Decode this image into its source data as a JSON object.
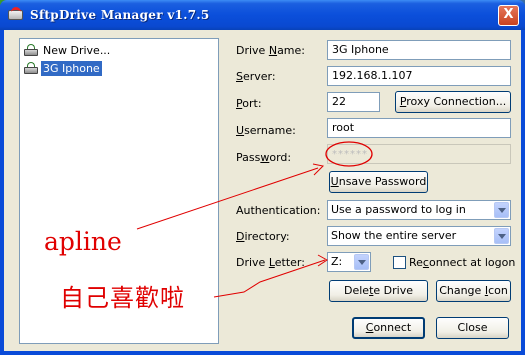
{
  "window": {
    "title": "SftpDrive Manager v1.7.5",
    "close_glyph": "X"
  },
  "drives": [
    {
      "label": "New Drive...",
      "icon": "network-drive-icon",
      "selected": false
    },
    {
      "label": "3G Iphone",
      "icon": "network-drive-icon",
      "selected": true
    }
  ],
  "labels": {
    "drive_name_pre": "Drive ",
    "drive_name_u": "N",
    "drive_name_post": "ame:",
    "server_u": "S",
    "server_post": "erver:",
    "port_u": "P",
    "port_post": "ort:",
    "username_u": "U",
    "username_post": "sername:",
    "password_pre": "Pass",
    "password_u": "w",
    "password_post": "ord:",
    "authentication": "Authentication:",
    "directory_u": "D",
    "directory_post": "irectory:",
    "drive_letter_pre": "Drive ",
    "drive_letter_u": "L",
    "drive_letter_post": "etter:"
  },
  "fields": {
    "drive_name": "3G Iphone",
    "server": "192.168.1.107",
    "port": "22",
    "username": "root",
    "password_mask": "******",
    "authentication": "Use a password to log in",
    "directory": "Show the entire server",
    "drive_letter": "Z:"
  },
  "buttons": {
    "proxy_u": "P",
    "proxy_post": "roxy Connection...",
    "unsave_u": "U",
    "unsave_post": "nsave Password",
    "delete_pre": "Dele",
    "delete_u": "t",
    "delete_post": "e Drive",
    "change_pre": "Change ",
    "change_u": "I",
    "change_post": "con",
    "connect_u": "C",
    "connect_post": "onnect",
    "close": "Close"
  },
  "checkbox": {
    "reconnect_pre": "Re",
    "reconnect_u": "c",
    "reconnect_post": "onnect at logon",
    "checked": false
  },
  "annotations": {
    "text1": "apline",
    "text2": "自己喜歡啦",
    "color": "#e00000"
  },
  "colors": {
    "titlebar": "#0b4fdb",
    "dialog_bg": "#ece9d8",
    "selection": "#316ac5"
  }
}
